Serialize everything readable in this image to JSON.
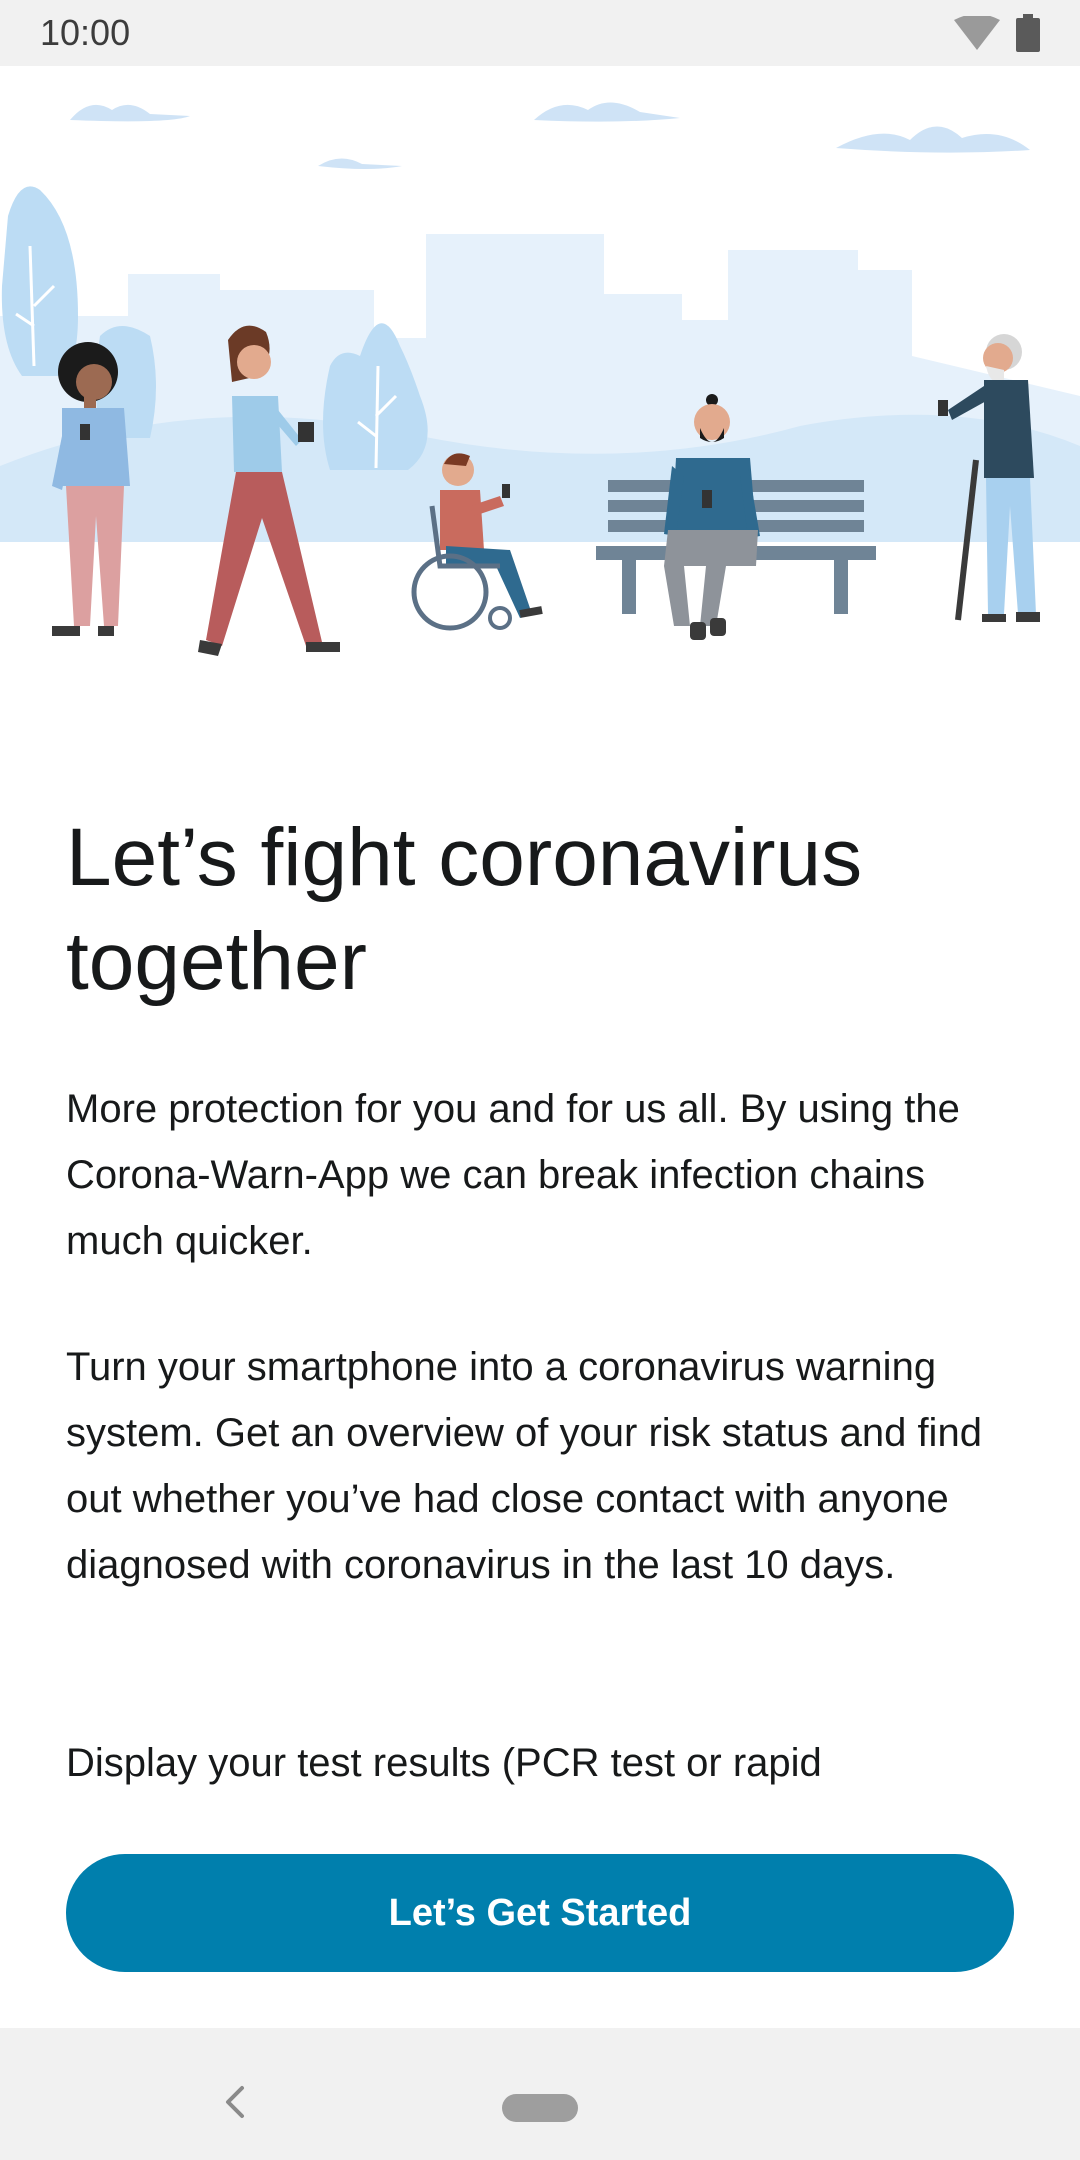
{
  "status_bar": {
    "time": "10:00"
  },
  "onboarding": {
    "title": "Let’s fight coronavirus together",
    "paragraph_1": "More protection for you and for us all. By using the Corona-Warn-App we can break infection chains much quicker.",
    "paragraph_2": "Turn your smartphone into a coronavirus warning system. Get an overview of your risk status and find out whether you’ve had close contact with anyone diagnosed with coronavirus in the last 10 days.",
    "paragraph_3": "Display your test results (PCR test or rapid",
    "cta_label": "Let’s Get Started"
  },
  "colors": {
    "accent": "#007fad",
    "illustration_sky": "#e6f1fb",
    "status_bar_bg": "#f1f1f1"
  },
  "icons": [
    "wifi-icon",
    "battery-icon",
    "back-icon",
    "home-pill-icon"
  ]
}
